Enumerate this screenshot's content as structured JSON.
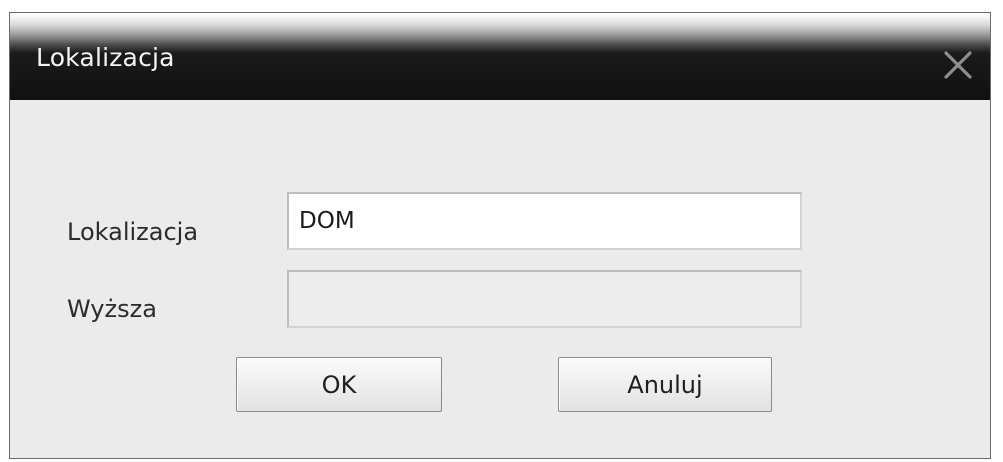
{
  "window": {
    "title": "Lokalizacja"
  },
  "form": {
    "location_label": "Lokalizacja",
    "location_value": "DOM",
    "parent_label": "Wyższa",
    "parent_value": ""
  },
  "buttons": {
    "ok_label": "OK",
    "cancel_label": "Anuluj"
  },
  "icons": {
    "close": "close-icon"
  }
}
